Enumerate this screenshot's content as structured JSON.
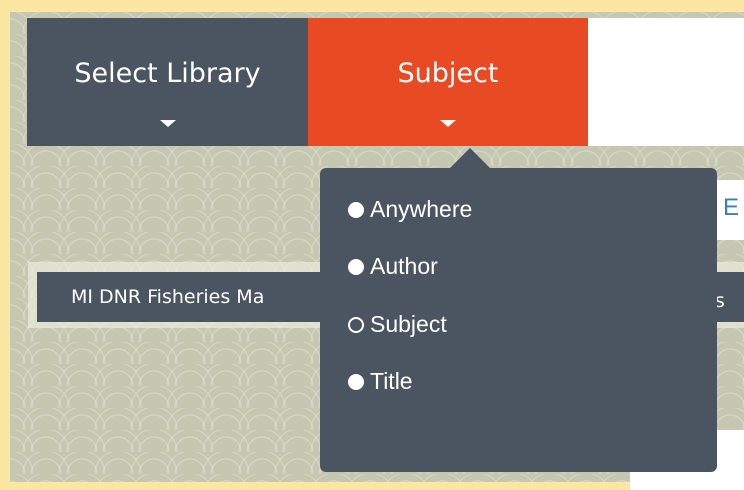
{
  "tabs": {
    "library_label": "Select Library",
    "subject_label": "Subject"
  },
  "library_selected": "MI DNR Fisheries Ma",
  "library_selected_right": "Fis",
  "right_box_letter": "E",
  "dropdown": {
    "options": [
      "Anywhere",
      "Author",
      "Subject",
      "Title"
    ],
    "selected": "Subject"
  },
  "colors": {
    "tab_dark": "#4b5561",
    "tab_accent": "#e84a24",
    "page_border": "#fbe7a1"
  }
}
